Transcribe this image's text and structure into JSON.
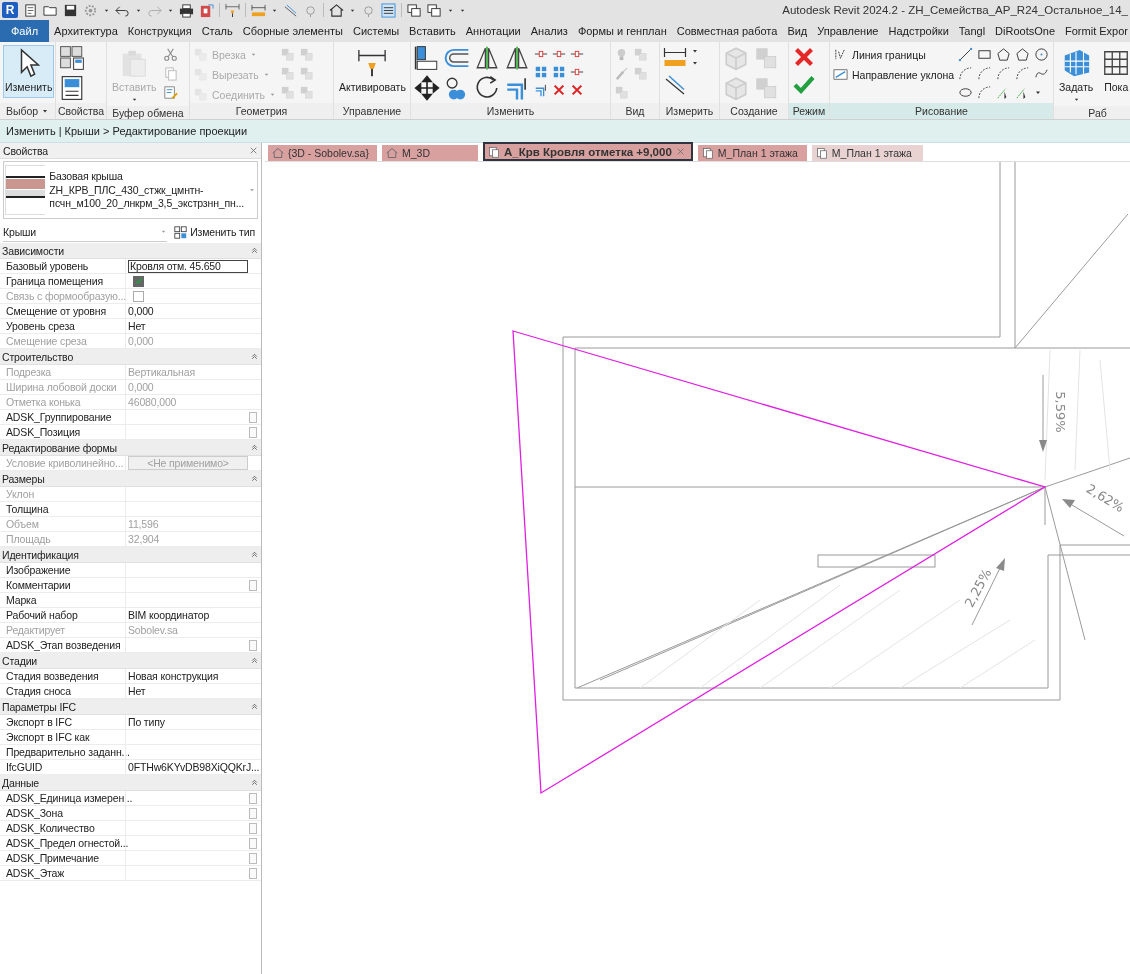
{
  "title_bar": {
    "logo": "R",
    "title": "Autodesk Revit 2024.2 - ZH_Семейства_АР_R24_Остальное_14_"
  },
  "ribbon_tabs": [
    {
      "label": "Файл",
      "kind": "file"
    },
    {
      "label": "Архитектура",
      "kind": "tab"
    },
    {
      "label": "Конструкция",
      "kind": "tab"
    },
    {
      "label": "Сталь",
      "kind": "tab"
    },
    {
      "label": "Сборные элементы",
      "kind": "tab"
    },
    {
      "label": "Системы",
      "kind": "tab"
    },
    {
      "label": "Вставить",
      "kind": "tab"
    },
    {
      "label": "Аннотации",
      "kind": "tab"
    },
    {
      "label": "Анализ",
      "kind": "tab"
    },
    {
      "label": "Формы и генплан",
      "kind": "tab"
    },
    {
      "label": "Совместная работа",
      "kind": "tab"
    },
    {
      "label": "Вид",
      "kind": "tab"
    },
    {
      "label": "Управление",
      "kind": "tab"
    },
    {
      "label": "Надстройки",
      "kind": "tab"
    },
    {
      "label": "Tangl",
      "kind": "tab"
    },
    {
      "label": "DiRootsOne",
      "kind": "tab"
    },
    {
      "label": "Formit Expor",
      "kind": "tab"
    }
  ],
  "ribbon_panels": [
    {
      "title": "Выбор",
      "dropdown": true,
      "contextual": false,
      "tools": [
        {
          "label": "Изменить",
          "kind": "large",
          "disabled": false,
          "selected": true,
          "dropdown": false
        }
      ]
    },
    {
      "title": "Свойства",
      "dropdown": false,
      "contextual": false
    },
    {
      "title": "Буфер обмена",
      "dropdown": false,
      "contextual": false,
      "tools": [
        {
          "label": "Вставить",
          "kind": "large",
          "disabled": true,
          "selected": false,
          "dropdown": true
        }
      ]
    },
    {
      "title": "Геометрия",
      "dropdown": false,
      "contextual": false,
      "tools": [
        {
          "label": "Врезка",
          "kind": "small",
          "disabled": true,
          "selected": false,
          "dropdown": true
        },
        {
          "label": "Вырезать",
          "kind": "small",
          "disabled": true,
          "selected": false,
          "dropdown": true
        },
        {
          "label": "Соединить",
          "kind": "small",
          "disabled": true,
          "selected": false,
          "dropdown": true
        }
      ]
    },
    {
      "title": "Управление",
      "dropdown": false,
      "contextual": false,
      "tools": [
        {
          "label": "Активировать",
          "kind": "large",
          "disabled": false,
          "selected": false,
          "dropdown": false
        }
      ]
    },
    {
      "title": "Изменить",
      "dropdown": false,
      "contextual": false
    },
    {
      "title": "Вид",
      "dropdown": false,
      "contextual": false
    },
    {
      "title": "Измерить",
      "dropdown": false,
      "contextual": false
    },
    {
      "title": "Создание",
      "dropdown": false,
      "contextual": false
    },
    {
      "title": "Режим",
      "dropdown": false,
      "contextual": true
    },
    {
      "title": "Рисование",
      "dropdown": false,
      "contextual": true,
      "tools": [
        {
          "label": "Линия границы",
          "kind": "small",
          "disabled": false,
          "selected": false,
          "dropdown": false
        },
        {
          "label": "Направление уклона",
          "kind": "small",
          "disabled": false,
          "selected": false,
          "dropdown": false
        }
      ]
    },
    {
      "title": "Раб",
      "dropdown": false,
      "contextual": false,
      "tools": [
        {
          "label": "Задать",
          "kind": "large",
          "disabled": false,
          "selected": false,
          "dropdown": true
        },
        {
          "label": "Пока",
          "kind": "large",
          "disabled": false,
          "selected": false,
          "dropdown": false
        }
      ]
    }
  ],
  "breadcrumb": "Изменить | Крыши > Редактирование проекции",
  "properties": {
    "title": "Свойства",
    "family": "Базовая крыша",
    "type_name": "ZH_КРВ_ПЛС_430_стжк_цмнтн-псчн_м100_20_лнкрм_3,5_экстрзнн_пн...",
    "category": "Крыши",
    "edit_type": "Изменить тип",
    "groups": [
      {
        "title": "Зависимости",
        "expanded": true,
        "rows": [
          {
            "label": "Базовый уровень",
            "value": "Кровля отм. 45.650",
            "kind": "field",
            "disabled": false,
            "action_box": false
          },
          {
            "label": "Граница помещения",
            "kind": "checkbox",
            "checked": true,
            "disabled": false,
            "action_box": false
          },
          {
            "label": "Связь с формообразую...",
            "kind": "checkbox",
            "checked": false,
            "disabled": true,
            "action_box": false
          },
          {
            "label": "Смещение от уровня",
            "value": "0,000",
            "kind": "text",
            "disabled": false,
            "action_box": false
          },
          {
            "label": "Уровень среза",
            "value": "Нет",
            "kind": "text",
            "disabled": false,
            "action_box": false
          },
          {
            "label": "Смещение среза",
            "value": "0,000",
            "kind": "text",
            "disabled": true,
            "action_box": false
          }
        ]
      },
      {
        "title": "Строительство",
        "expanded": true,
        "rows": [
          {
            "label": "Подрезка",
            "value": "Вертикальная",
            "kind": "text",
            "disabled": true,
            "action_box": false
          },
          {
            "label": "Ширина лобовой доски",
            "value": "0,000",
            "kind": "text",
            "disabled": true,
            "action_box": false
          },
          {
            "label": "Отметка конька",
            "value": "46080,000",
            "kind": "text",
            "disabled": true,
            "action_box": false
          },
          {
            "label": "ADSK_Группирование",
            "kind": "text",
            "disabled": false,
            "action_box": true
          },
          {
            "label": "ADSK_Позиция",
            "kind": "text",
            "disabled": false,
            "action_box": true
          }
        ]
      },
      {
        "title": "Редактирование формы",
        "expanded": true,
        "rows": [
          {
            "label": "Условие криволинейно...",
            "value": "<Не применимо>",
            "kind": "button",
            "disabled": true,
            "action_box": false
          }
        ]
      },
      {
        "title": "Размеры",
        "expanded": true,
        "rows": [
          {
            "label": "Уклон",
            "kind": "text",
            "disabled": true,
            "action_box": false
          },
          {
            "label": "Толщина",
            "kind": "text",
            "disabled": false,
            "action_box": false
          },
          {
            "label": "Объем",
            "value": "11,596",
            "kind": "text",
            "disabled": true,
            "action_box": false
          },
          {
            "label": "Площадь",
            "value": "32,904",
            "kind": "text",
            "disabled": true,
            "action_box": false
          }
        ]
      },
      {
        "title": "Идентификация",
        "expanded": true,
        "rows": [
          {
            "label": "Изображение",
            "kind": "text",
            "disabled": false,
            "action_box": false
          },
          {
            "label": "Комментарии",
            "kind": "text",
            "disabled": false,
            "action_box": true
          },
          {
            "label": "Марка",
            "kind": "text",
            "disabled": false,
            "action_box": false
          },
          {
            "label": "Рабочий набор",
            "value": "BIM координатор",
            "kind": "text",
            "disabled": false,
            "action_box": false
          },
          {
            "label": "Редактирует",
            "value": "Sobolev.sa",
            "kind": "text",
            "disabled": true,
            "action_box": false
          },
          {
            "label": "ADSK_Этап возведения",
            "kind": "text",
            "disabled": false,
            "action_box": true
          }
        ]
      },
      {
        "title": "Стадии",
        "expanded": true,
        "rows": [
          {
            "label": "Стадия возведения",
            "value": "Новая конструкция",
            "kind": "text",
            "disabled": false,
            "action_box": false
          },
          {
            "label": "Стадия сноса",
            "value": "Нет",
            "kind": "text",
            "disabled": false,
            "action_box": false
          }
        ]
      },
      {
        "title": "Параметры IFC",
        "expanded": true,
        "rows": [
          {
            "label": "Экспорт в IFC",
            "value": "По типу",
            "kind": "text",
            "disabled": false,
            "action_box": false
          },
          {
            "label": "Экспорт в IFC как",
            "kind": "text",
            "disabled": false,
            "action_box": false
          },
          {
            "label": "Предварительно заданн...",
            "kind": "text",
            "disabled": false,
            "action_box": false
          },
          {
            "label": "IfcGUID",
            "value": "0FTHw6KYvDB98XiQQKrJ...",
            "kind": "text",
            "disabled": false,
            "action_box": false
          }
        ]
      },
      {
        "title": "Данные",
        "expanded": true,
        "rows": [
          {
            "label": "ADSK_Единица измерен...",
            "kind": "text",
            "disabled": false,
            "action_box": true
          },
          {
            "label": "ADSK_Зона",
            "kind": "text",
            "disabled": false,
            "action_box": true
          },
          {
            "label": "ADSK_Количество",
            "kind": "text",
            "disabled": false,
            "action_box": true
          },
          {
            "label": "ADSK_Предел огнестой...",
            "kind": "text",
            "disabled": false,
            "action_box": true
          },
          {
            "label": "ADSK_Примечание",
            "kind": "text",
            "disabled": false,
            "action_box": true
          },
          {
            "label": "ADSK_Этаж",
            "kind": "text",
            "disabled": false,
            "action_box": true
          }
        ]
      }
    ]
  },
  "view_tabs": [
    {
      "label": "{3D - Sobolev.sa}",
      "kind": "model",
      "color": "#d9a0a0",
      "selected": false
    },
    {
      "label": "M_3D",
      "kind": "model",
      "color": "#d9a0a0",
      "selected": false
    },
    {
      "label": "А_Крв Кровля отметка +9,000",
      "kind": "plan",
      "color": "#d9a0a0",
      "selected": true
    },
    {
      "label": "М_План 1 этажа",
      "kind": "plan",
      "color": "#d9a0a0",
      "selected": false
    },
    {
      "label": "М_План 1 этажа",
      "kind": "plan",
      "color": "#e8d2d2",
      "selected": false
    }
  ],
  "view": {
    "slope_labels": [
      "5,59%",
      "2,62%",
      "2,25%"
    ]
  }
}
